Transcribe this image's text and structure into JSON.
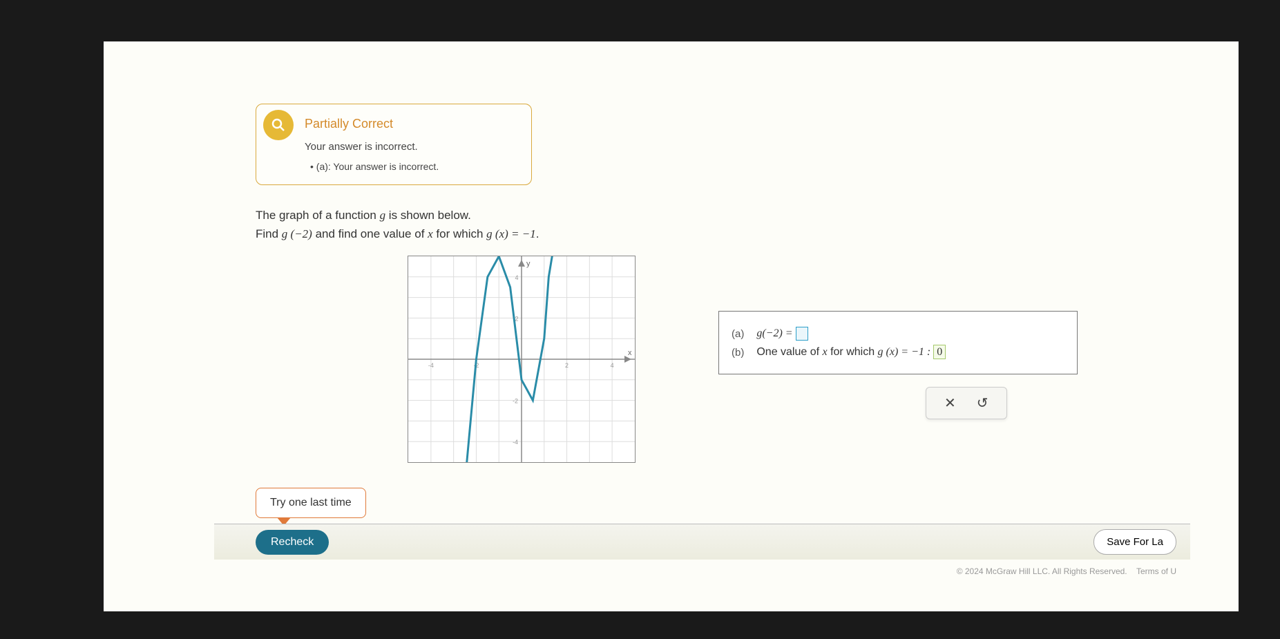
{
  "feedback": {
    "title": "Partially Correct",
    "subtitle": "Your answer is incorrect.",
    "bullet": "(a): Your answer is incorrect."
  },
  "question": {
    "line1_pre": "The graph of a function ",
    "line1_fn": "g",
    "line1_post": " is shown below.",
    "line2_pre": "Find ",
    "line2_expr1": "g (−2)",
    "line2_mid": " and find one value of ",
    "line2_var": "x",
    "line2_mid2": " for which ",
    "line2_expr2": "g (x) = −1",
    "line2_end": "."
  },
  "answers": {
    "a_label": "(a)",
    "a_expr": "g(−2) = ",
    "a_value": "",
    "b_label": "(b)",
    "b_text_pre": "One value of ",
    "b_var": "x",
    "b_text_mid": " for which ",
    "b_expr": "g (x) = −1 : ",
    "b_value": "0"
  },
  "buttons": {
    "clear_icon": "✕",
    "reset_icon": "↺",
    "try_last": "Try one last time",
    "recheck": "Recheck",
    "save_later": "Save For La"
  },
  "footer": {
    "copyright": "© 2024 McGraw Hill LLC. All Rights Reserved.",
    "terms": "Terms of U"
  },
  "chart_data": {
    "type": "line",
    "title": "",
    "xlabel": "x",
    "ylabel": "y",
    "xlim": [
      -5,
      5
    ],
    "ylim": [
      -5,
      5
    ],
    "series": [
      {
        "name": "g(x)",
        "x": [
          -2.5,
          -2,
          -1.5,
          -1,
          -0.5,
          0,
          0.5,
          1,
          1.2,
          1.5
        ],
        "values": [
          -6,
          0,
          4,
          5,
          3.5,
          -1,
          -2,
          1,
          4,
          6
        ]
      }
    ]
  }
}
